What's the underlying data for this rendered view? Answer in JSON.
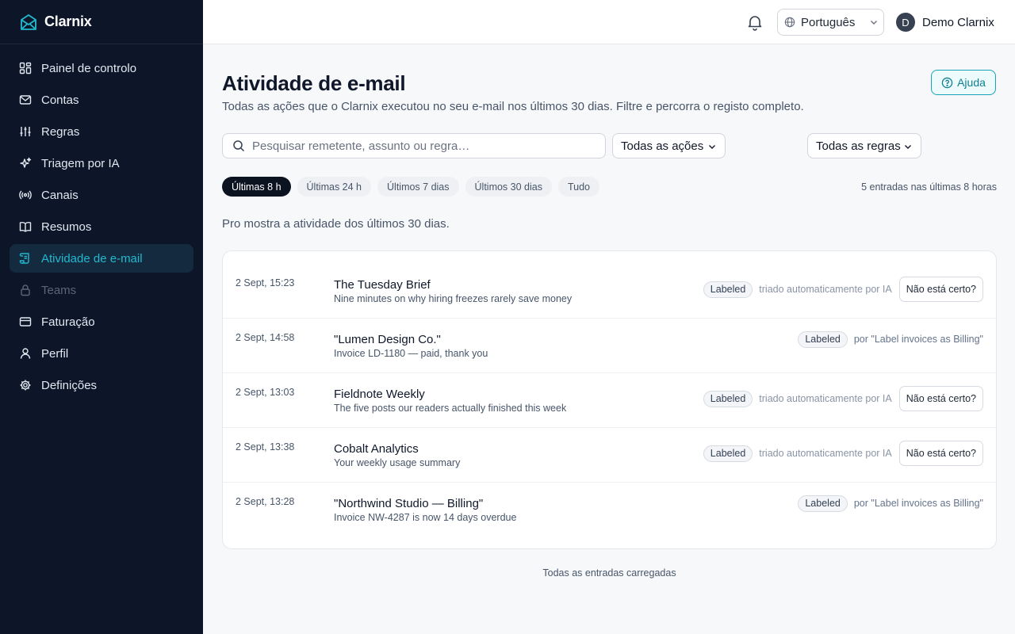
{
  "brand": {
    "name": "Clarnix",
    "accent": "#22b8cf"
  },
  "sidebar": {
    "items": [
      {
        "label": "Painel de controlo",
        "icon": "dashboard-icon"
      },
      {
        "label": "Contas",
        "icon": "mail-icon"
      },
      {
        "label": "Regras",
        "icon": "sliders-icon"
      },
      {
        "label": "Triagem por IA",
        "icon": "sparkles-icon"
      },
      {
        "label": "Canais",
        "icon": "broadcast-icon"
      },
      {
        "label": "Resumos",
        "icon": "book-icon"
      },
      {
        "label": "Atividade de e-mail",
        "icon": "scroll-icon",
        "active": true
      },
      {
        "label": "Teams",
        "icon": "lock-icon",
        "disabled": true
      },
      {
        "label": "Faturação",
        "icon": "credit-card-icon"
      },
      {
        "label": "Perfil",
        "icon": "user-icon"
      },
      {
        "label": "Definições",
        "icon": "gear-icon"
      }
    ]
  },
  "topbar": {
    "language": "Português",
    "user_initial": "D",
    "user_name": "Demo Clarnix"
  },
  "page": {
    "title": "Atividade de e-mail",
    "subtitle": "Todas as ações que o Clarnix executou no seu e-mail nos últimos 30 dias. Filtre e percorra o registo completo.",
    "help_label": "Ajuda"
  },
  "filters": {
    "search_placeholder": "Pesquisar remetente, assunto ou regra…",
    "actions_select": "Todas as ações",
    "rules_select": "Todas as regras",
    "pills": [
      "Últimas 8 h",
      "Últimas 24 h",
      "Últimos 7 dias",
      "Últimos 30 dias",
      "Tudo"
    ],
    "active_pill": 0,
    "count_text": "5 entradas nas últimas 8 horas"
  },
  "pro_note": "Pro mostra a atividade dos últimos 30 dias.",
  "entries": [
    {
      "time": "2 Sept, 15:23",
      "title": "The Tuesday Brief",
      "subtitle": "Nine minutes on why hiring freezes rarely save money",
      "badge": "Labeled",
      "note": "triado automaticamente por IA",
      "wrong_label": "Não está certo?"
    },
    {
      "time": "2 Sept, 14:58",
      "title": "\"Lumen Design Co.\"",
      "subtitle": "Invoice LD-1180 — paid, thank you",
      "badge": "Labeled",
      "note": "por \"Label invoices as Billing\""
    },
    {
      "time": "2 Sept, 13:03",
      "title": "Fieldnote Weekly",
      "subtitle": "The five posts our readers actually finished this week",
      "badge": "Labeled",
      "note": "triado automaticamente por IA",
      "wrong_label": "Não está certo?"
    },
    {
      "time": "2 Sept, 13:38",
      "title": "Cobalt Analytics",
      "subtitle": "Your weekly usage summary",
      "badge": "Labeled",
      "note": "triado automaticamente por IA",
      "wrong_label": "Não está certo?"
    },
    {
      "time": "2 Sept, 13:28",
      "title": "\"Northwind Studio — Billing\"",
      "subtitle": "Invoice NW-4287 is now 14 days overdue",
      "badge": "Labeled",
      "note": "por \"Label invoices as Billing\""
    }
  ],
  "footer_text": "Todas as entradas carregadas"
}
